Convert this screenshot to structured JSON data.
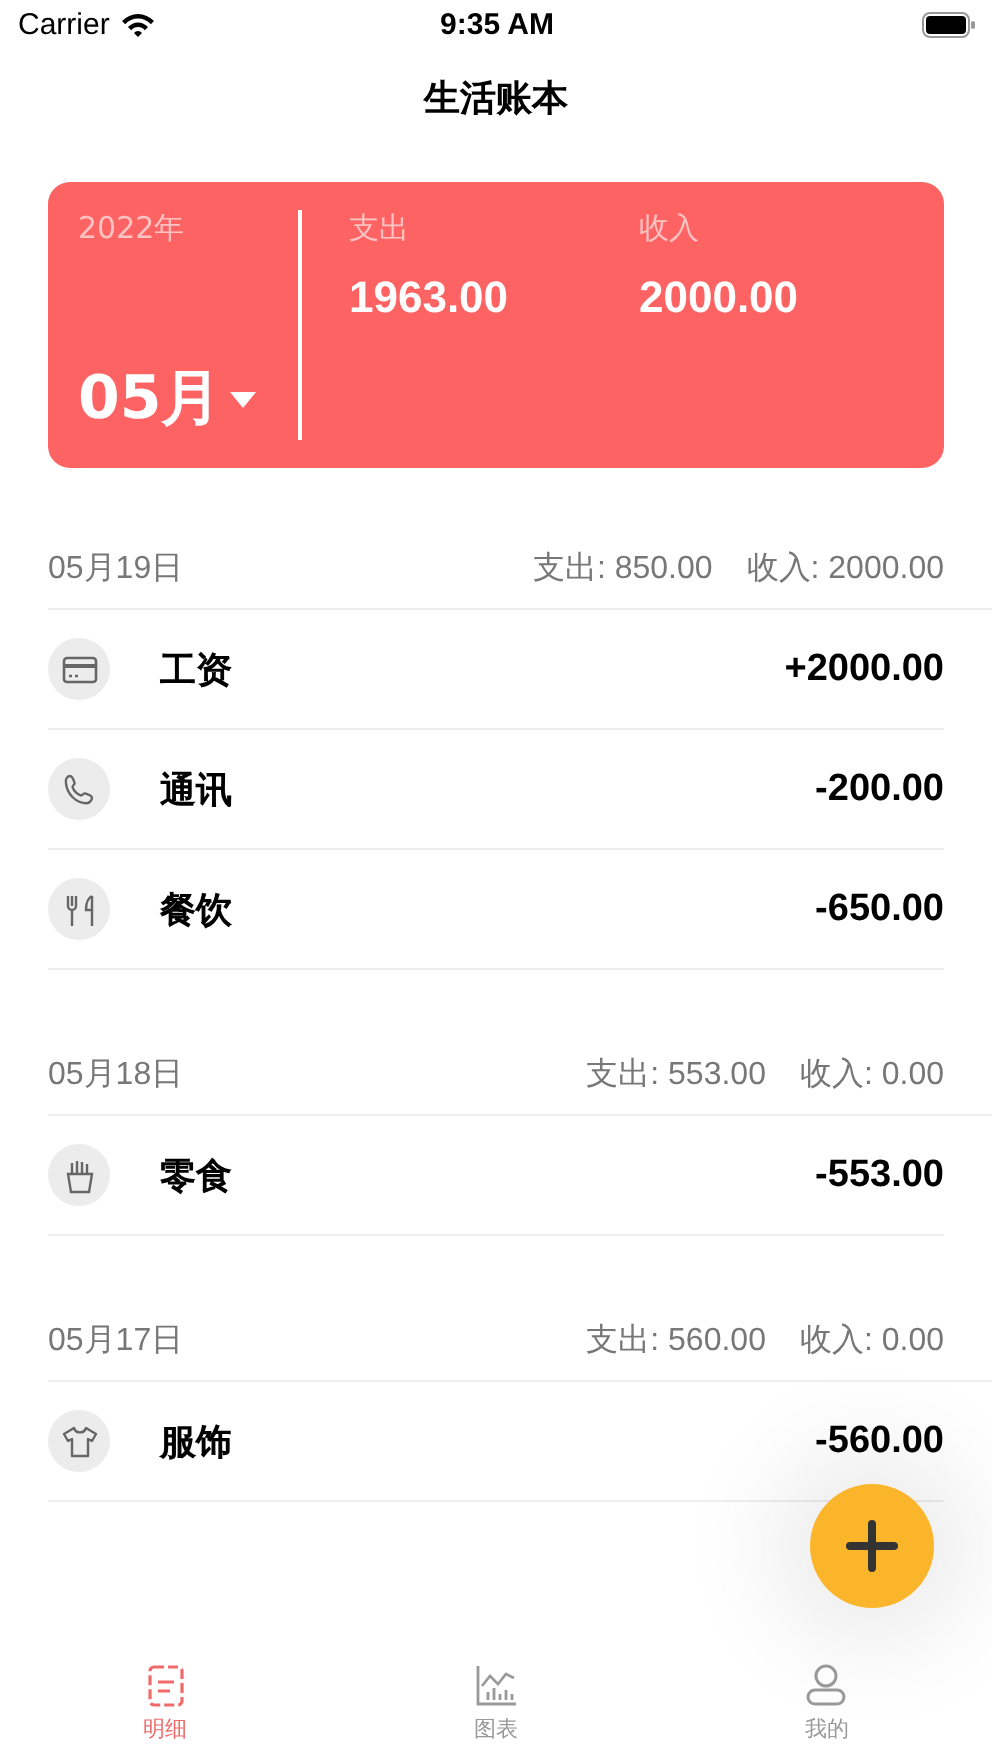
{
  "status_bar": {
    "carrier": "Carrier",
    "time": "9:35 AM"
  },
  "title": "生活账本",
  "summary": {
    "year": "2022年",
    "month": "05月",
    "expense_label": "支出",
    "expense": "1963.00",
    "income_label": "收入",
    "income": "2000.00"
  },
  "days": [
    {
      "date": "05月19日",
      "expense": "支出: 850.00",
      "income": "收入: 2000.00",
      "entries": [
        {
          "kind": "card",
          "name": "工资",
          "amount": "+2000.00"
        },
        {
          "kind": "phone",
          "name": "通讯",
          "amount": "-200.00"
        },
        {
          "kind": "food",
          "name": "餐饮",
          "amount": "-650.00"
        }
      ]
    },
    {
      "date": "05月18日",
      "expense": "支出: 553.00",
      "income": "收入: 0.00",
      "entries": [
        {
          "kind": "snack",
          "name": "零食",
          "amount": "-553.00"
        }
      ]
    },
    {
      "date": "05月17日",
      "expense": "支出: 560.00",
      "income": "收入: 0.00",
      "entries": [
        {
          "kind": "clothes",
          "name": "服饰",
          "amount": "-560.00"
        }
      ]
    }
  ],
  "tabs": [
    {
      "kind": "list",
      "label": "明细",
      "selected": true
    },
    {
      "kind": "chart",
      "label": "图表",
      "selected": false
    },
    {
      "kind": "user",
      "label": "我的",
      "selected": false
    }
  ]
}
